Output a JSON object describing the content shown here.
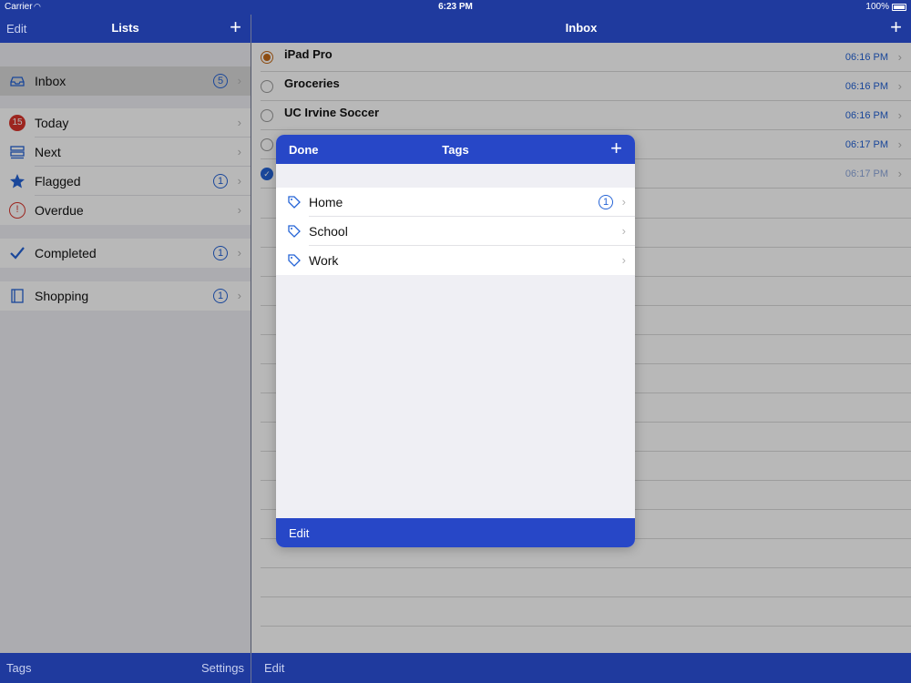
{
  "status_bar": {
    "carrier": "Carrier",
    "time": "6:23 PM",
    "battery": "100%"
  },
  "sidebar": {
    "edit_label": "Edit",
    "title": "Lists",
    "items": [
      {
        "label": "Inbox",
        "icon": "inbox-icon",
        "badge": "5",
        "selected": true
      },
      {
        "label": "Today",
        "icon": "calendar-today-icon",
        "day": "15"
      },
      {
        "label": "Next",
        "icon": "stack-icon"
      },
      {
        "label": "Flagged",
        "icon": "star-icon",
        "badge": "1"
      },
      {
        "label": "Overdue",
        "icon": "warning-icon"
      },
      {
        "label": "Completed",
        "icon": "checkmark-icon",
        "badge": "1"
      },
      {
        "label": "Shopping",
        "icon": "list-book-icon",
        "badge": "1"
      }
    ],
    "bottom": {
      "tags_label": "Tags",
      "settings_label": "Settings"
    }
  },
  "main": {
    "title": "Inbox",
    "tasks": [
      {
        "title": "iPad Pro",
        "time": "06:16 PM",
        "status": "flagged"
      },
      {
        "title": "Groceries",
        "time": "06:16 PM",
        "status": "open"
      },
      {
        "title": "UC Irvine Soccer",
        "time": "06:16 PM",
        "status": "open"
      },
      {
        "title": "",
        "time": "06:17 PM",
        "status": "open"
      },
      {
        "title": "",
        "time": "06:17 PM",
        "status": "completed"
      }
    ],
    "bottom": {
      "edit_label": "Edit"
    }
  },
  "tags_popover": {
    "done_label": "Done",
    "title": "Tags",
    "tags": [
      {
        "label": "Home",
        "badge": "1"
      },
      {
        "label": "School"
      },
      {
        "label": "Work"
      }
    ],
    "edit_label": "Edit"
  },
  "colors": {
    "bar": "#1f3a9e",
    "popover_bar": "#2747c7",
    "accent": "#2463d6"
  }
}
